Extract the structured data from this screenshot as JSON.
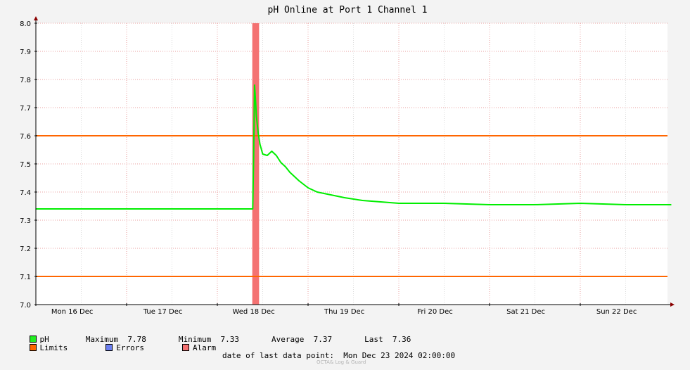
{
  "chart_data": {
    "type": "line",
    "title": "pH Online at Port 1 Channel 1",
    "ylim": [
      7.0,
      8.0
    ],
    "y_ticks": [
      "7.0",
      "7.1",
      "7.2",
      "7.3",
      "7.4",
      "7.5",
      "7.6",
      "7.7",
      "7.8",
      "7.9",
      "8.0"
    ],
    "x_tick_labels": [
      "Mon 16 Dec",
      "Tue 17 Dec",
      "Wed 18 Dec",
      "Thu 19 Dec",
      "Fri 20 Dec",
      "Sat 21 Dec",
      "Sun 22 Dec"
    ],
    "grid": true,
    "series": [
      {
        "name": "pH",
        "color": "#00ee00",
        "x_days": [
          0.0,
          0.5,
          1.0,
          1.5,
          2.0,
          2.39,
          2.4,
          2.41,
          2.42,
          2.43,
          2.44,
          2.45,
          2.47,
          2.5,
          2.55,
          2.6,
          2.65,
          2.7,
          2.75,
          2.8,
          2.9,
          3.0,
          3.1,
          3.25,
          3.4,
          3.6,
          3.8,
          4.0,
          4.5,
          5.0,
          5.5,
          6.0,
          6.5,
          7.0
        ],
        "values": [
          7.34,
          7.34,
          7.34,
          7.34,
          7.34,
          7.34,
          7.52,
          7.78,
          7.73,
          7.67,
          7.64,
          7.61,
          7.57,
          7.535,
          7.53,
          7.545,
          7.53,
          7.505,
          7.49,
          7.47,
          7.44,
          7.415,
          7.4,
          7.39,
          7.38,
          7.37,
          7.365,
          7.36,
          7.36,
          7.355,
          7.355,
          7.36,
          7.355,
          7.355
        ]
      }
    ],
    "limits": {
      "name": "Limits",
      "color": "#ff6600",
      "values": [
        7.6,
        7.1
      ]
    },
    "errors": {
      "name": "Errors",
      "color": "#6c7ff0"
    },
    "alarm": {
      "name": "Alarm",
      "color": "#f47272",
      "x_start_days": 2.385,
      "x_end_days": 2.46
    }
  },
  "legend": {
    "ph_label": "pH",
    "maximum_label": "Maximum",
    "maximum_value": "7.78",
    "minimum_label": "Minimum",
    "minimum_value": "7.33",
    "average_label": "Average",
    "average_value": "7.37",
    "last_label": "Last",
    "last_value": "7.36",
    "limits_label": "Limits",
    "errors_label": "Errors",
    "alarm_label": "Alarm"
  },
  "footer": {
    "label": "date of last data point:",
    "value": "Mon Dec 23 2024 02:00:00",
    "watermark": "OCTA& Log & Guard"
  }
}
